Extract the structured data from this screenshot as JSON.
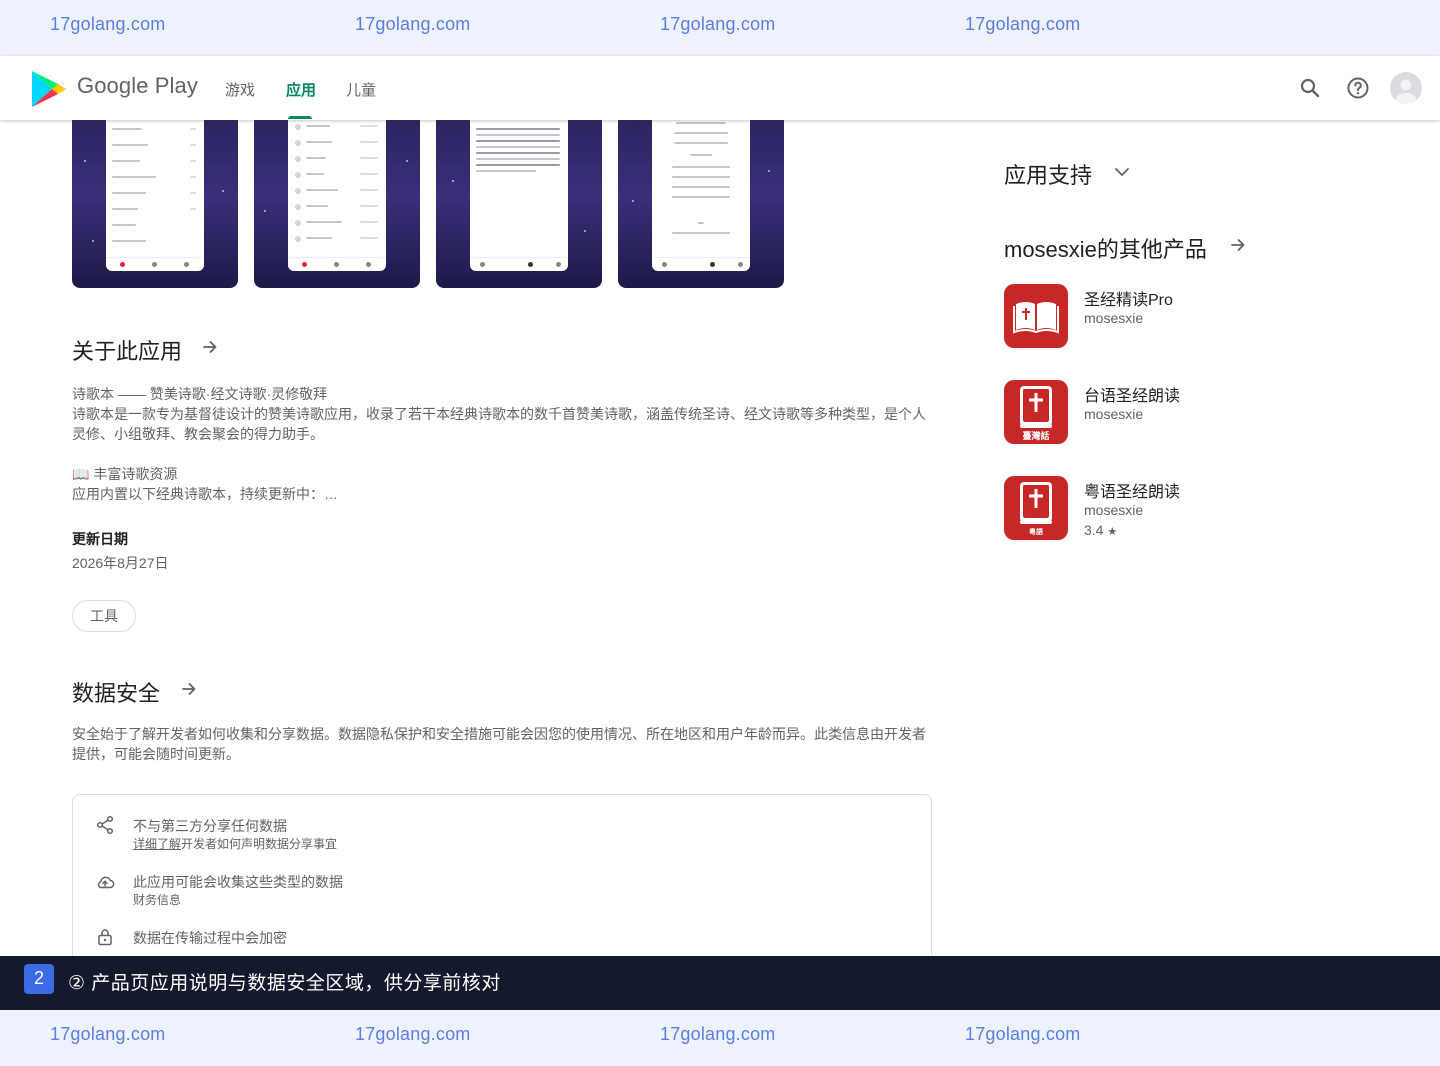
{
  "watermark": {
    "text": "17golang.com"
  },
  "header": {
    "brand": "Google Play",
    "nav": [
      "游戏",
      "应用",
      "儿童"
    ],
    "active_nav": "应用",
    "icons": [
      "search-icon",
      "help-icon",
      "avatar"
    ]
  },
  "about": {
    "title": "关于此应用",
    "line1": "诗歌本 —— 赞美诗歌·经文诗歌·灵修敬拜",
    "line2": "诗歌本是一款专为基督徒设计的赞美诗歌应用，收录了若干本经典诗歌本的数千首赞美诗歌，涵盖传统圣诗、经文诗歌等多种类型，是个人灵修、小组敬拜、教会聚会的得力助手。",
    "line3": "📖 丰富诗歌资源",
    "line4": "应用内置以下经典诗歌本，持续更新中：…",
    "updated_label": "更新日期",
    "updated_value": "2026年8月27日",
    "category_chip": "工具"
  },
  "data_safety": {
    "title": "数据安全",
    "description": "安全始于了解开发者如何收集和分享数据。数据隐私保护和安全措施可能会因您的使用情况、所在地区和用户年龄而异。此类信息由开发者提供，可能会随时间更新。",
    "items": [
      {
        "icon": "share-icon",
        "main": "不与第三方分享任何数据",
        "sub_link": "详细了解",
        "sub": "开发者如何声明数据分享事宜"
      },
      {
        "icon": "cloud-upload-icon",
        "main": "此应用可能会收集这些类型的数据",
        "sub": "财务信息"
      },
      {
        "icon": "lock-icon",
        "main": "数据在传输过程中会加密"
      }
    ]
  },
  "sidebar": {
    "support_title": "应用支持",
    "more_title": "mosesxie的其他产品",
    "apps": [
      {
        "name": "圣经精读Pro",
        "developer": "mosesxie",
        "rating": ""
      },
      {
        "name": "台语圣经朗读",
        "developer": "mosesxie",
        "rating": "",
        "icon_label": "臺灣話"
      },
      {
        "name": "粤语圣经朗读",
        "developer": "mosesxie",
        "rating": "3.4",
        "icon_label": "粵語"
      }
    ]
  },
  "banner": {
    "step": "2",
    "text": "② 产品页应用说明与数据安全区域，供分享前核对"
  },
  "colors": {
    "accent": "#01875f",
    "app_icon_red": "#c62828",
    "banner_bg": "#141a2e",
    "step_badge": "#3d6be6"
  }
}
